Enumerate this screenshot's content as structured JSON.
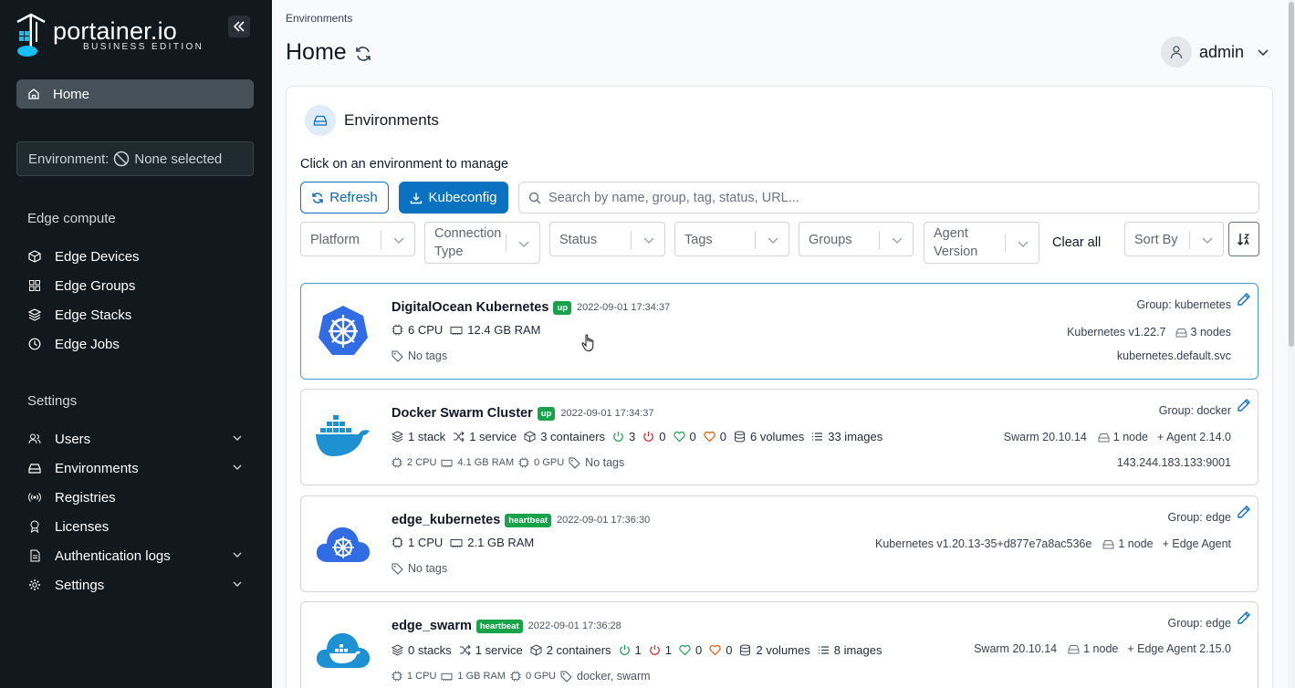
{
  "brand": {
    "name": "portainer.io",
    "edition": "BUSINESS EDITION"
  },
  "sidebar": {
    "home_label": "Home",
    "environment_prefix": "Environment:",
    "environment_value": "None selected",
    "edge_section": "Edge compute",
    "edge_items": [
      "Edge Devices",
      "Edge Groups",
      "Edge Stacks",
      "Edge Jobs"
    ],
    "settings_section": "Settings",
    "settings_items": [
      "Users",
      "Environments",
      "Registries",
      "Licenses",
      "Authentication logs",
      "Settings"
    ]
  },
  "header": {
    "breadcrumb": "Environments",
    "title": "Home",
    "username": "admin"
  },
  "panel": {
    "title": "Environments",
    "instructions": "Click on an environment to manage",
    "refresh_label": "Refresh",
    "kubeconfig_label": "Kubeconfig",
    "search_placeholder": "Search by name, group, tag, status, URL...",
    "filters": [
      "Platform",
      "Connection Type",
      "Status",
      "Tags",
      "Groups",
      "Agent Version"
    ],
    "clear_all": "Clear all",
    "sort_by": "Sort By"
  },
  "environments": [
    {
      "name": "DigitalOcean Kubernetes",
      "status": "up",
      "timestamp": "2022-09-01 17:34:37",
      "cpu": "6 CPU",
      "ram": "12.4 GB RAM",
      "tags": "No tags",
      "group": "Group: kubernetes",
      "version": "Kubernetes v1.22.7",
      "nodes": "3 nodes",
      "url": "kubernetes.default.svc"
    },
    {
      "name": "Docker Swarm Cluster",
      "status": "up",
      "timestamp": "2022-09-01 17:34:37",
      "stacks": "1 stack",
      "services": "1 service",
      "containers": "3 containers",
      "running": "3",
      "stopped": "0",
      "healthy": "0",
      "unhealthy": "0",
      "volumes": "6 volumes",
      "images": "33 images",
      "cpu": "2 CPU",
      "ram": "4.1 GB RAM",
      "gpu": "0 GPU",
      "tags": "No tags",
      "group": "Group: docker",
      "version": "Swarm 20.10.14",
      "nodes": "1 node",
      "agent": "+ Agent 2.14.0",
      "url": "143.244.183.133:9001"
    },
    {
      "name": "edge_kubernetes",
      "status": "heartbeat",
      "timestamp": "2022-09-01 17:36:30",
      "cpu": "1 CPU",
      "ram": "2.1 GB RAM",
      "tags": "No tags",
      "group": "Group: edge",
      "version": "Kubernetes v1.20.13-35+d877e7a8ac536e",
      "nodes": "1 node",
      "agent": "+ Edge Agent"
    },
    {
      "name": "edge_swarm",
      "status": "heartbeat",
      "timestamp": "2022-09-01 17:36:28",
      "stacks": "0 stacks",
      "services": "1 service",
      "containers": "2 containers",
      "running": "1",
      "stopped": "1",
      "healthy": "0",
      "unhealthy": "0",
      "volumes": "2 volumes",
      "images": "8 images",
      "cpu": "1 CPU",
      "ram": "1 GB RAM",
      "gpu": "0 GPU",
      "tags": "docker, swarm",
      "group": "Group: edge",
      "version": "Swarm 20.10.14",
      "nodes": "1 node",
      "agent": "+ Edge Agent 2.15.0"
    }
  ],
  "colors": {
    "sidebar_bg": "#11191f",
    "primary": "#0b72c1",
    "status_green": "#16a34a",
    "selected_border": "#3b9de0"
  }
}
